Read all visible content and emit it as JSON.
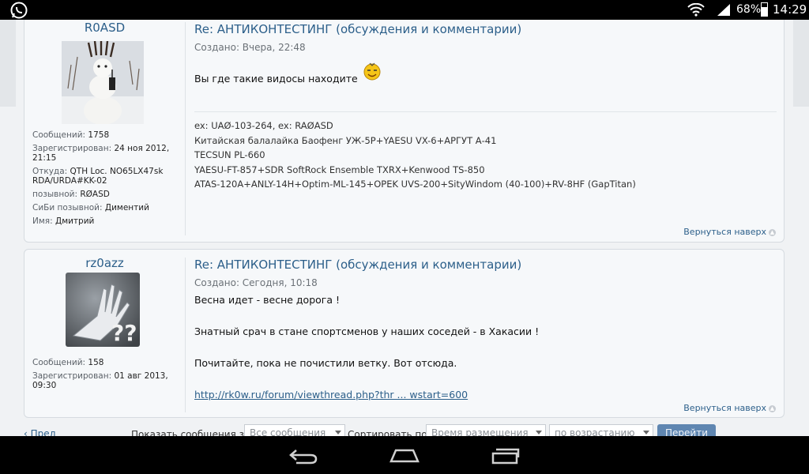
{
  "status_bar": {
    "battery": "68%",
    "time": "14:29",
    "battery_level": 0.68
  },
  "posts": [
    {
      "username": "R0ASD",
      "stats": [
        {
          "label": "Сообщений:",
          "value": "1758"
        },
        {
          "label": "Зарегистрирован:",
          "value": "24 ноя 2012, 21:15"
        },
        {
          "label": "Откуда:",
          "value": "QTH Loc. NO65LX47sk RDA/URDA#KK-02"
        },
        {
          "label": "позывной:",
          "value": "RØASD"
        },
        {
          "label": "СиБи позывной:",
          "value": "Диментий"
        },
        {
          "label": "Имя:",
          "value": "Дмитрий"
        }
      ],
      "title": "Re: АНТИКОНТЕСТИНГ (обсуждения и комментарии)",
      "date": "Создано: Вчера, 22:48",
      "body": [
        "Вы где такие видосы находите"
      ],
      "signature": [
        "ex: UAØ-103-264, ex: RAØASD",
        "Китайская балалайка Баофенг УЖ-5Р+YAESU VX-6+АРГУТ А-41",
        "TECSUN PL-660",
        "YAESU-FT-857+SDR SoftRock Ensemble TXRX+Kenwood TS-850",
        "ATAS-120A+ANLY-14H+Optim-ML-145+OPEK UVS-200+SityWindom (40-100)+RV-8HF (GapTitan)"
      ],
      "back_to_top": "Вернуться наверх"
    },
    {
      "username": "rz0azz",
      "stats": [
        {
          "label": "Сообщений:",
          "value": "158"
        },
        {
          "label": "Зарегистрирован:",
          "value": "01 авг 2013, 09:30"
        }
      ],
      "title": "Re: АНТИКОНТЕСТИНГ (обсуждения и комментарии)",
      "date": "Создано: Сегодня, 10:18",
      "body": [
        "Весна идет - весне дорога !",
        "Знатный срач в стане спортсменов у наших соседей - в Хакасии !",
        "Почитайте, пока не почистили ветку. Вот отсюда."
      ],
      "link": "http://rk0w.ru/forum/viewthread.php?thr ... wstart=600",
      "back_to_top": "Вернуться наверх"
    }
  ],
  "toolbar": {
    "prev": "Пред",
    "show_label": "Показать сообщения за:",
    "show_value": "Все сообщения",
    "sort_label": "Сортировать по:",
    "sort_value": "Время размещения",
    "order_value": "по возрастанию",
    "go": "Перейти"
  }
}
